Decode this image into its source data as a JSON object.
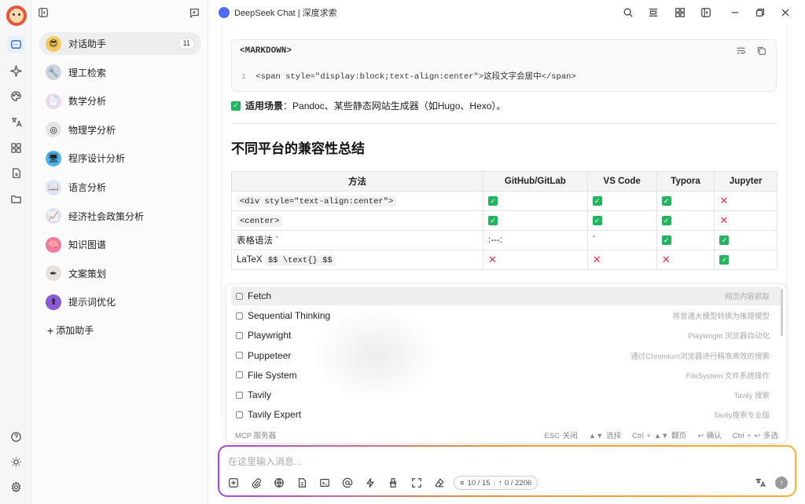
{
  "window": {
    "title": "DeepSeek Chat | 深度求索"
  },
  "sidebar": {
    "assistants": [
      {
        "label": "对话助手",
        "count": "11",
        "icon": "sunglasses-emoji",
        "color": "#f4c95d"
      },
      {
        "label": "理工检索",
        "icon": "wrench-icon",
        "color": "#cfd4dc"
      },
      {
        "label": "数学分析",
        "icon": "document-icon",
        "color": "#f1d7e8"
      },
      {
        "label": "物理学分析",
        "icon": "fingerprint-icon",
        "color": "#e5e5e5"
      },
      {
        "label": "程序设计分析",
        "icon": "monitor-icon",
        "color": "#4fb3ea"
      },
      {
        "label": "语言分析",
        "icon": "book-icon",
        "color": "#dbe6f7"
      },
      {
        "label": "经济社会政策分析",
        "icon": "chart-icon",
        "color": "#dfe3f0"
      },
      {
        "label": "知识图谱",
        "icon": "brain-icon",
        "color": "#f27aa0"
      },
      {
        "label": "文案策划",
        "icon": "pen-icon",
        "color": "#e7e2dc"
      },
      {
        "label": "提示词优化",
        "icon": "top-icon",
        "color": "#8a5bd6"
      }
    ],
    "add_label": "添加助手"
  },
  "message": {
    "code_lang": "<MARKDOWN>",
    "code_line_no": "1",
    "code_line": "<span style=\"display:block;text-align:center\">这段文字会居中</span>",
    "scene_bold": "适用场景",
    "scene_text": "：Pandoc、某些静态网站生成器（如Hugo、Hexo）。",
    "heading": "不同平台的兼容性总结",
    "table": {
      "headers": [
        "方法",
        "GitHub/GitLab",
        "VS Code",
        "Typora",
        "Jupyter"
      ],
      "rows": [
        {
          "method": "<div style=\"text-align:center\">",
          "code": true,
          "cells": [
            "check",
            "check",
            "check",
            "cross"
          ]
        },
        {
          "method": "<center>",
          "code": true,
          "cells": [
            "check",
            "check",
            "check",
            "cross"
          ]
        },
        {
          "method": "表格语法 `",
          "code": false,
          "cells": [
            ":---:",
            "`",
            "check",
            "check"
          ]
        },
        {
          "method": "LaTeX ",
          "method_code": "$$ \\text{} $$",
          "code": false,
          "cells": [
            "cross",
            "cross",
            "cross",
            "check"
          ]
        }
      ]
    }
  },
  "mcp": {
    "options": [
      {
        "name": "Fetch",
        "desc": "网页内容抓取"
      },
      {
        "name": "Sequential Thinking",
        "desc": "将普通大模型转换为推理模型"
      },
      {
        "name": "Playwright",
        "desc": "Playwright 浏览器自动化"
      },
      {
        "name": "Puppeteer",
        "desc": "通过Chromium浏览器进行精准高效的搜索"
      },
      {
        "name": "File System",
        "desc": "FileSystem 文件系统操作"
      },
      {
        "name": "Tavily",
        "desc": "Tavily 搜索"
      },
      {
        "name": "Tavily Expert",
        "desc": "Tavily搜索专业版"
      }
    ],
    "footer_title": "MCP 服务器",
    "hints": [
      "ESC 关闭",
      "▲▼ 选择",
      "Ctrl + ▲▼ 翻页",
      "↩ 确认",
      "Ctrl + ↩ 多选"
    ]
  },
  "input": {
    "placeholder": "在这里输入消息...",
    "context_count": "10 / 15",
    "token_count": "0 / 2206"
  },
  "colors": {
    "accent": "#2a6ff0",
    "check": "#22b55e",
    "cross": "#e5334a"
  }
}
